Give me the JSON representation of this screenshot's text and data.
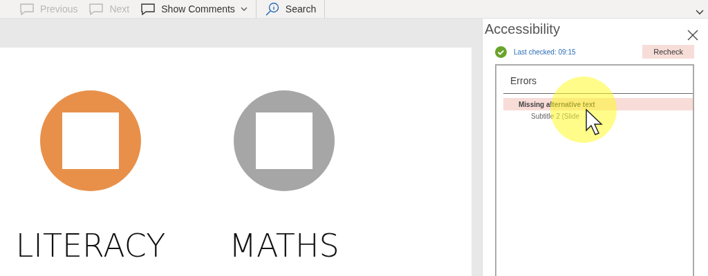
{
  "toolbar": {
    "buttons": [
      {
        "label": "Previous",
        "disabled": true,
        "kind": "comment",
        "dropdown": false
      },
      {
        "label": "Next",
        "disabled": true,
        "kind": "comment",
        "dropdown": false
      },
      {
        "label": "Show Comments",
        "disabled": false,
        "kind": "comment",
        "dropdown": true
      },
      {
        "label": "Search",
        "disabled": false,
        "kind": "search",
        "dropdown": false
      }
    ]
  },
  "slide": {
    "items": [
      {
        "label": "LITERACY",
        "color": "#e8904a"
      },
      {
        "label": "MATHS",
        "color": "#a6a6a6"
      }
    ]
  },
  "pane": {
    "title": "Accessibility",
    "status": "Last checked: 09:15",
    "recheck": "Recheck",
    "errors": {
      "heading": "Errors",
      "items": [
        {
          "title": "Missing alternative text",
          "selected": true,
          "children": [
            {
              "label": "Subtitle 2 (Slide"
            }
          ]
        }
      ]
    }
  }
}
